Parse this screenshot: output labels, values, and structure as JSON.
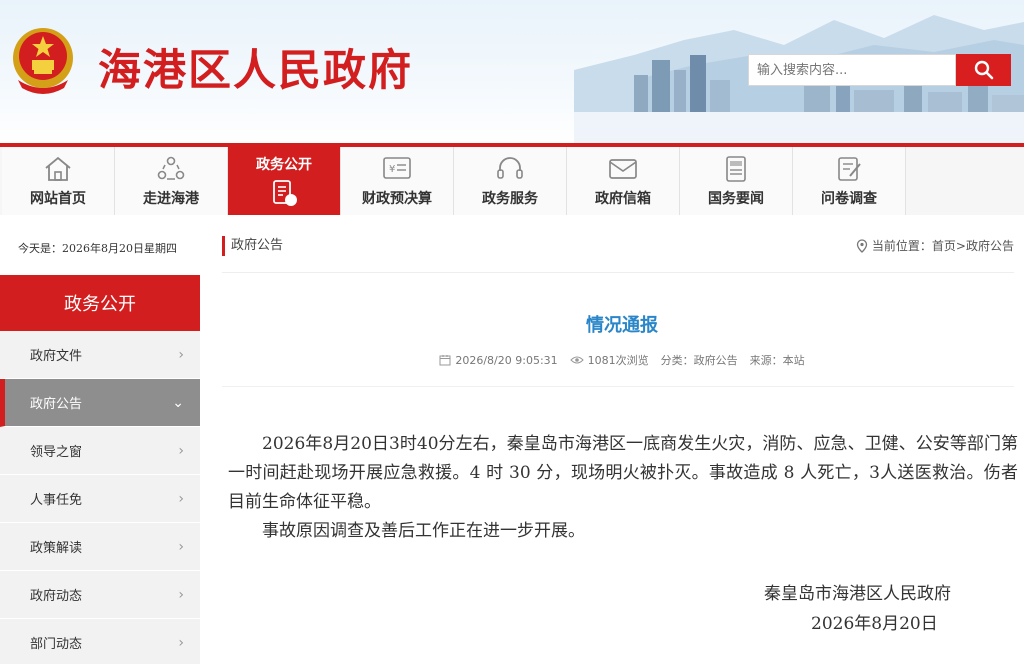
{
  "header": {
    "site_title": "海港区人民政府",
    "search_placeholder": "输入搜索内容..."
  },
  "nav": {
    "items": [
      {
        "label": "网站首页",
        "icon": "home-icon"
      },
      {
        "label": "走进海港",
        "icon": "people-icon"
      },
      {
        "label": "政务公开",
        "icon": "document-icon",
        "active": true
      },
      {
        "label": "财政预决算",
        "icon": "finance-icon"
      },
      {
        "label": "政务服务",
        "icon": "headset-icon"
      },
      {
        "label": "政府信箱",
        "icon": "mail-icon"
      },
      {
        "label": "国务要闻",
        "icon": "news-icon"
      },
      {
        "label": "问卷调查",
        "icon": "survey-icon"
      }
    ]
  },
  "date_line": "今天是：2026年8月20日星期四",
  "sidebar": {
    "heading": "政务公开",
    "items": [
      {
        "label": "政府文件"
      },
      {
        "label": "政府公告",
        "active": true
      },
      {
        "label": "领导之窗"
      },
      {
        "label": "人事任免"
      },
      {
        "label": "政策解读"
      },
      {
        "label": "政府动态"
      },
      {
        "label": "部门动态"
      }
    ]
  },
  "breadcrumb": {
    "section": "政府公告",
    "location_label": "当前位置：",
    "home": "首页",
    "separator": ">",
    "current": "政府公告"
  },
  "article": {
    "title": "情况通报",
    "datetime": "2026/8/20 9:05:31",
    "views": "1081次浏览",
    "category": "分类：政府公告",
    "source": "来源：本站",
    "paragraphs": [
      "2026年8月20日3时40分左右，秦皇岛市海港区一底商发生火灾，消防、应急、卫健、公安等部门第一时间赶赴现场开展应急救援。4 时 30 分，现场明火被扑灭。事故造成 8 人死亡，3人送医救治。伤者目前生命体征平稳。",
      "事故原因调查及善后工作正在进一步开展。"
    ],
    "signature_org": "秦皇岛市海港区人民政府",
    "signature_date": "2026年8月20日"
  },
  "colors": {
    "brand_red": "#d21e1e",
    "title_blue": "#2a86c8",
    "sidebar_active": "#8e8e8e"
  }
}
